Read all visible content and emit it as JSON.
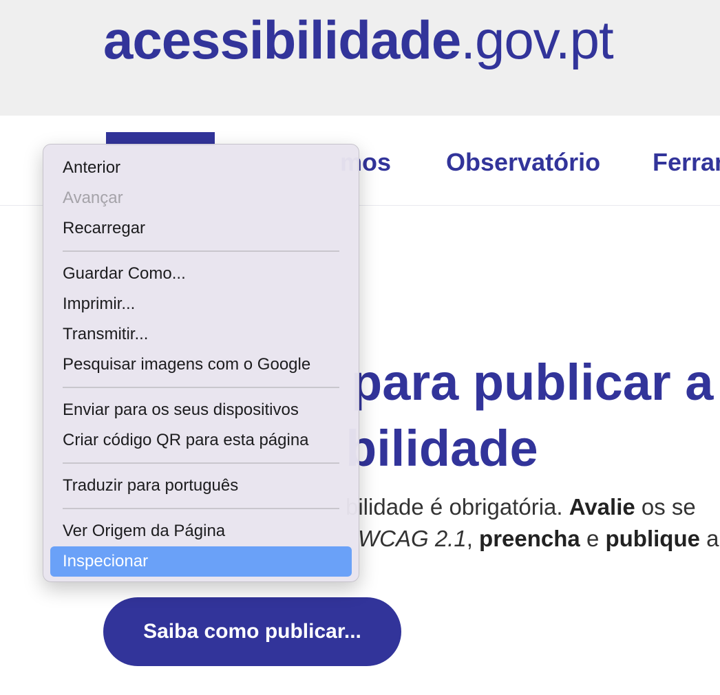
{
  "header": {
    "logo_bold": "acessibilidade",
    "logo_light": ".gov.pt"
  },
  "nav": {
    "items": [
      "mos",
      "Observatório",
      "Ferran"
    ]
  },
  "hero": {
    "title_line1": "para publicar a",
    "title_line2": "bilidade",
    "text_line1_a": "bilidade é obrigatória. ",
    "text_line1_b": "Avalie",
    "text_line1_c": " os se",
    "text_line2_a": "WCAG 2.1",
    "text_line2_b": ", ",
    "text_line2_c": "preencha",
    "text_line2_d": " e ",
    "text_line2_e": "publique",
    "text_line2_f": " a",
    "cta_label": "Saiba como publicar..."
  },
  "context_menu": {
    "items": [
      "Anterior",
      "Avançar",
      "Recarregar",
      "Guardar Como...",
      "Imprimir...",
      "Transmitir...",
      "Pesquisar imagens com o Google",
      "Enviar para os seus dispositivos",
      "Criar código QR para esta página",
      "Traduzir para português",
      "Ver Origem da Página",
      "Inspecionar"
    ]
  },
  "colors": {
    "brand": "#32349a",
    "header_bg": "#efefef",
    "menu_highlight": "#6aa1f8"
  }
}
